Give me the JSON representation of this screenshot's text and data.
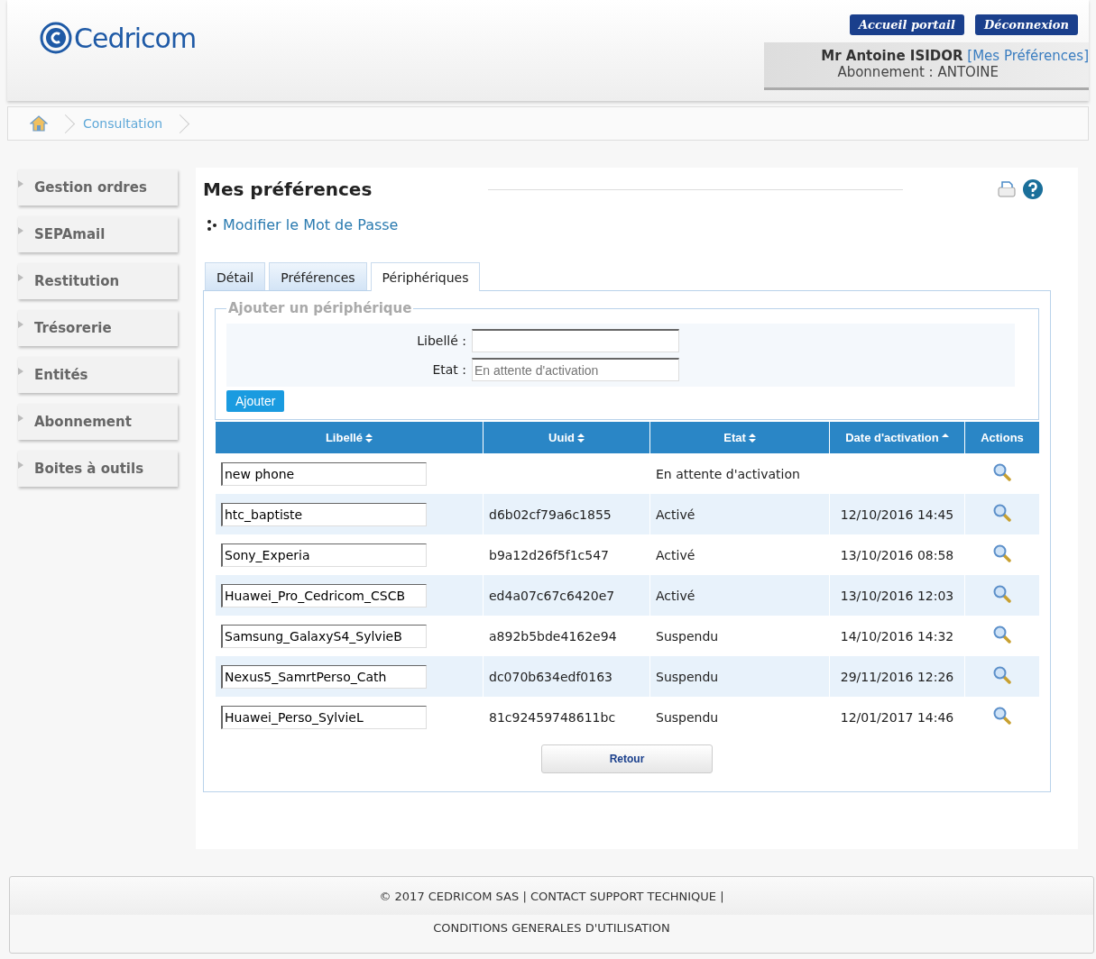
{
  "header": {
    "logo_text": "Cedricom",
    "buttons": [
      "Accueil portail",
      "Déconnexion"
    ],
    "user_name": "Mr Antoine ISIDOR",
    "preferences_link": "[Mes Préférences]",
    "subscription": "Abonnement : ANTOINE"
  },
  "breadcrumb": [
    "Consultation"
  ],
  "sidebar": {
    "items": [
      "Gestion ordres",
      "SEPAmail",
      "Restitution",
      "Trésorerie",
      "Entités",
      "Abonnement",
      "Boites à outils"
    ]
  },
  "page": {
    "title": "Mes préférences",
    "password_link": "Modifier le Mot de Passe",
    "tabs": [
      {
        "label": "Détail",
        "selected": false
      },
      {
        "label": "Préférences",
        "selected": false
      },
      {
        "label": "Périphériques",
        "selected": true
      }
    ],
    "form": {
      "legend": "Ajouter un périphérique",
      "fields": [
        {
          "label": "Libellé :"
        },
        {
          "label": "Etat :",
          "placeholder": "En attente d'activation"
        }
      ],
      "button": "Ajouter"
    },
    "table": {
      "columns": [
        {
          "label": "Libellé",
          "sortable": true,
          "sorted": false
        },
        {
          "label": "Uuid",
          "sortable": true,
          "sorted": false
        },
        {
          "label": "Etat",
          "sortable": true,
          "sorted": false
        },
        {
          "label": "Date d'activation",
          "sortable": true,
          "sorted": true
        },
        {
          "label": "Actions",
          "sortable": false,
          "sorted": false
        }
      ],
      "rows": [
        {
          "name": "new phone",
          "uuid": "",
          "state": "En attente d'activation",
          "date": ""
        },
        {
          "name": "htc_baptiste",
          "uuid": "d6b02cf79a6c1855",
          "state": "Activé",
          "date": "12/10/2016 14:45"
        },
        {
          "name": "Sony_Experia",
          "uuid": "b9a12d26f5f1c547",
          "state": "Activé",
          "date": "13/10/2016 08:58"
        },
        {
          "name": "Huawei_Pro_Cedricom_CSCB",
          "uuid": "ed4a07c67c6420e7",
          "state": "Activé",
          "date": "13/10/2016 12:03"
        },
        {
          "name": "Samsung_GalaxyS4_SylvieB",
          "uuid": "a892b5bde4162e94",
          "state": "Suspendu",
          "date": "14/10/2016 14:32"
        },
        {
          "name": "Nexus5_SamrtPerso_Cath",
          "uuid": "dc070b634edf0163",
          "state": "Suspendu",
          "date": "29/11/2016 12:26"
        },
        {
          "name": "Huawei_Perso_SylvieL",
          "uuid": "81c92459748611bc",
          "state": "Suspendu",
          "date": "12/01/2017 14:46"
        }
      ]
    },
    "back_button": "Retour"
  },
  "footer": {
    "lines": [
      "© 2017 CEDRICOM SAS | CONTACT SUPPORT TECHNIQUE |",
      "CONDITIONS GENERALES D'UTILISATION"
    ]
  }
}
